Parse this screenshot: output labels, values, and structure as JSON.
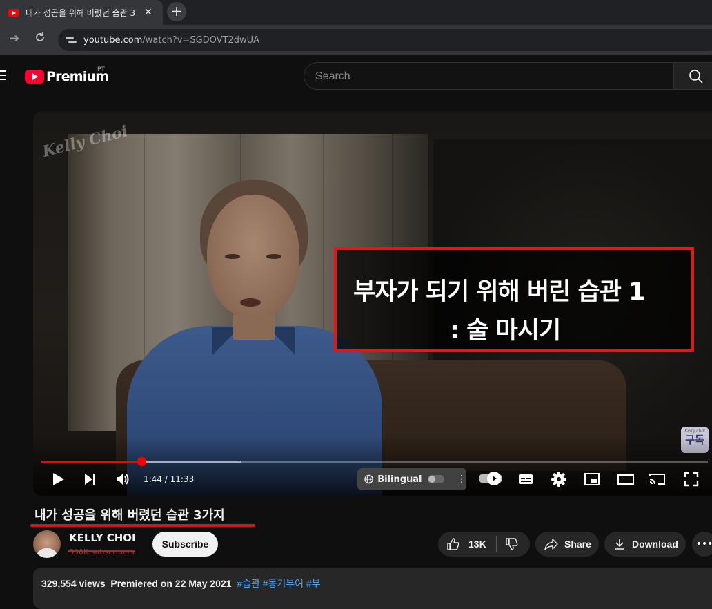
{
  "browser": {
    "tab_title": "내가 성공을 위해 버렸던 습관 3",
    "url_host": "youtube.com",
    "url_path": "/watch?v=SGDOVT2dwUA",
    "new_tab_label": "+",
    "close_label": "✕"
  },
  "header": {
    "logo_text": "Premium",
    "logo_region": "PT",
    "search_placeholder": "Search"
  },
  "player": {
    "watermark": "Kelly Choi",
    "caption_line1": "부자가 되기 위해 버린 습관 1",
    "caption_line2": ": 술 마시기",
    "subscribe_badge_small": "Kelly choi",
    "subscribe_badge_big": "구독",
    "time_display": "1:44 / 11:33",
    "progress_fraction": 0.15,
    "buffered_fraction": 0.3,
    "bilingual_label": "Bilingual"
  },
  "video": {
    "title": "내가 성공을 위해 버렸던 습관 3가지",
    "channel_name": "KELLY CHOI",
    "subscribers": "590K subscribers",
    "subscribe_label": "Subscribe",
    "like_count": "13K",
    "share_label": "Share",
    "download_label": "Download",
    "views": "329,554 views",
    "premiered": "Premiered on 22 May 2021",
    "tags": [
      "#습관",
      "#동기부여",
      "#부"
    ]
  },
  "colors": {
    "annotation_red": "#e8141c",
    "youtube_red": "#ff0000",
    "link_blue": "#3ea6ff"
  }
}
